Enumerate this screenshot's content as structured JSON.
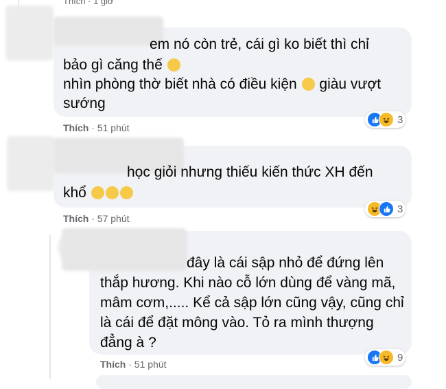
{
  "header": {
    "time_text": "Thích · 1 giờ"
  },
  "comments": [
    {
      "lines": [
        "em nó còn trẻ, cái gì ko biết thì chỉ",
        "bảo gì căng thế",
        "nhìn phòng thờ biết nhà có điều kiện",
        "giàu vượt",
        "sướng"
      ],
      "like_label": "Thích",
      "time": "51 phút",
      "reaction_count": "3",
      "reactions": [
        "like-icon",
        "haha-icon"
      ]
    },
    {
      "lines": [
        "học giỏi nhưng thiếu kiến thức XH đến",
        "khổ"
      ],
      "like_label": "Thích",
      "time": "57 phút",
      "reaction_count": "3",
      "reactions": [
        "haha-icon",
        "like-icon"
      ]
    },
    {
      "lines": [
        "đây là cái sập nhỏ để đứng lên",
        "thắp hương. Khi nào cỗ lớn dùng để vàng mã,",
        "mâm cơm,..... Kể cả sập lớn cũng vậy, cũng chỉ",
        "là cái để đặt mông vào. Tỏ ra mình thượng",
        "đẳng à ?"
      ],
      "like_label": "Thích",
      "time": "51 phút",
      "reaction_count": "9",
      "reactions": [
        "like-icon",
        "haha-icon"
      ]
    }
  ],
  "separator": " · ",
  "colors": {
    "bubble": "#f0f2f5",
    "meta_text": "#65676b",
    "like_blue": "#1877f2",
    "emoji_yellow": "#f7b928"
  }
}
